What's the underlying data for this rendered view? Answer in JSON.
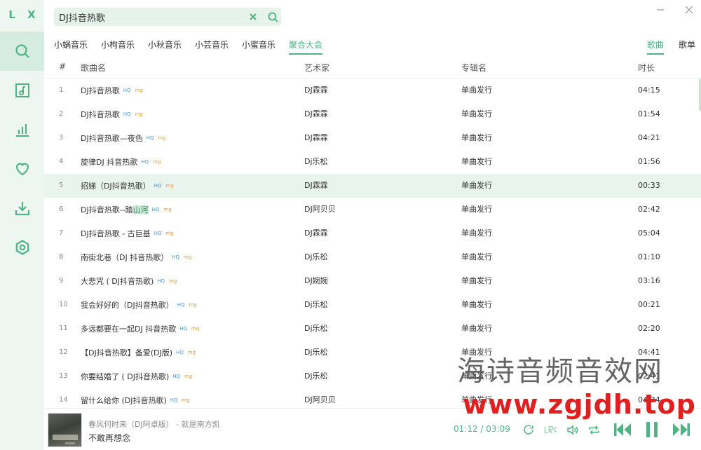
{
  "app": {
    "logo": "L X",
    "accent": "#4fb383"
  },
  "sidebar": {
    "items": [
      {
        "icon": "search-icon",
        "active": true
      },
      {
        "icon": "music-list-icon",
        "active": false
      },
      {
        "icon": "leaderboard-icon",
        "active": false
      },
      {
        "icon": "heart-icon",
        "active": false
      },
      {
        "icon": "download-icon",
        "active": false
      },
      {
        "icon": "settings-icon",
        "active": false
      }
    ]
  },
  "search": {
    "value": "DJ抖音热歌",
    "placeholder": ""
  },
  "window": {
    "minimize": "–",
    "close": "×"
  },
  "sources": [
    "小蜗音乐",
    "小枸音乐",
    "小秋音乐",
    "小芸音乐",
    "小蜜音乐",
    "聚合大会"
  ],
  "source_active": "聚合大会",
  "types": [
    "歌曲",
    "歌单"
  ],
  "table": {
    "headers": {
      "num": "#",
      "name": "歌曲名",
      "artist": "艺术家",
      "album": "专辑名",
      "duration": "时长"
    },
    "rows": [
      {
        "num": "1",
        "name": "DJ抖音热歌",
        "hq": "HQ",
        "mg": "mg",
        "artist": "DJ霖霖",
        "album": "单曲发行",
        "duration": "04:15"
      },
      {
        "num": "2",
        "name": "DJ抖音热歌",
        "hq": "HQ",
        "mg": "mg",
        "artist": "DJ霖霖",
        "album": "单曲发行",
        "duration": "01:54"
      },
      {
        "num": "3",
        "name": "DJ抖音热歌—夜色",
        "hq": "HQ",
        "mg": "mg",
        "artist": "DJ霖霖",
        "album": "单曲发行",
        "duration": "04:21"
      },
      {
        "num": "4",
        "name": "旋律DJ 抖音热歌",
        "hq": "HQ",
        "mg": "mg",
        "artist": "Dj乐松",
        "album": "单曲发行",
        "duration": "01:56"
      },
      {
        "num": "5",
        "name": "招娣（DJ抖音热歌）",
        "hq": "HQ",
        "mg": "mg",
        "artist": "DJ霖霖",
        "album": "单曲发行",
        "duration": "00:33"
      },
      {
        "num": "6",
        "name": "DJ抖音热歌--踏",
        "name_mark": "山河",
        "hq": "HQ",
        "mg": "mg",
        "artist": "DJ阿贝贝",
        "album": "单曲发行",
        "duration": "02:42"
      },
      {
        "num": "7",
        "name": "DJ抖音热歌 - 古巨基",
        "hq": "HQ",
        "mg": "mg",
        "artist": "DJ霖霖",
        "album": "单曲发行",
        "duration": "05:04"
      },
      {
        "num": "8",
        "name": "南街北巷（DJ 抖音热歌）",
        "hq": "HQ",
        "mg": "mg",
        "artist": "Dj乐松",
        "album": "单曲发行",
        "duration": "01:10"
      },
      {
        "num": "9",
        "name": "大悲咒 ( DJ抖音热歌)",
        "hq": "HQ",
        "mg": "mg",
        "artist": "DJ婉婉",
        "album": "单曲发行",
        "duration": "03:16"
      },
      {
        "num": "10",
        "name": "我会好好的（DJ抖音热歌）",
        "hq": "HQ",
        "mg": "mg",
        "artist": "Dj乐松",
        "album": "单曲发行",
        "duration": "00:21"
      },
      {
        "num": "11",
        "name": "多远都要在一起DJ 抖音热歌",
        "hq": "HQ",
        "mg": "mg",
        "artist": "Dj乐松",
        "album": "单曲发行",
        "duration": "02:20"
      },
      {
        "num": "12",
        "name": "【DJ抖音热歌】备爱(DJ版)",
        "hq": "HQ",
        "mg": "mg",
        "artist": "Dj乐松",
        "album": "单曲发行",
        "duration": "04:41"
      },
      {
        "num": "13",
        "name": "你要结婚了 ( DJ抖音热歌)",
        "hq": "HQ",
        "mg": "mg",
        "artist": "Dj乐松",
        "album": "单曲发行",
        "duration": "02:41"
      },
      {
        "num": "14",
        "name": "留什么给你 (DJ抖音热歌)",
        "hq": "HQ",
        "mg": "mg",
        "artist": "DJ阿贝贝",
        "album": "单曲发行",
        "duration": "04:34"
      }
    ]
  },
  "player": {
    "title": "春风何时来（DJ阿卓版） - 就是南方凯",
    "lyric": "不敢再想念",
    "current": "01:12",
    "sep": "/",
    "total": "03:09"
  },
  "watermark": {
    "line1": "海诗音频音效网",
    "line2": "www.zgjdh.top"
  }
}
